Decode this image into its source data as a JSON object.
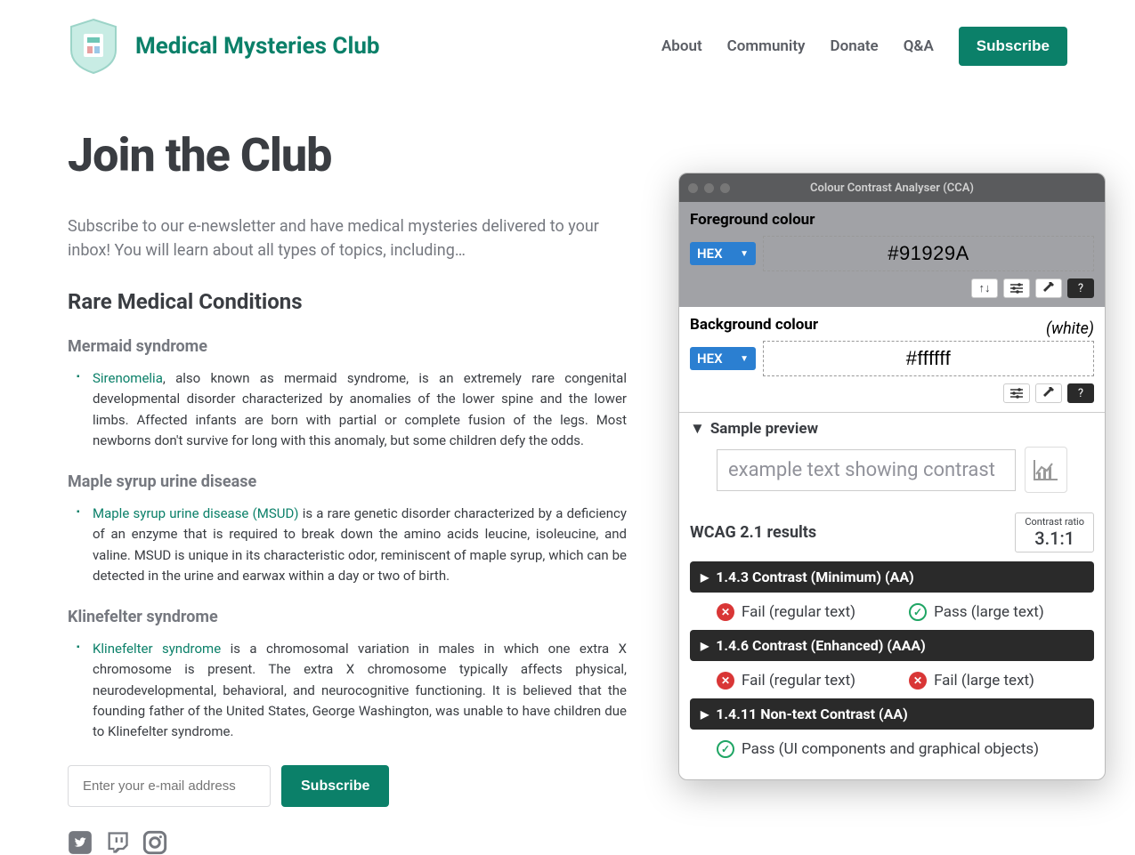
{
  "header": {
    "brand": "Medical Mysteries Club",
    "nav": {
      "about": "About",
      "community": "Community",
      "donate": "Donate",
      "qa": "Q&A"
    },
    "subscribe": "Subscribe"
  },
  "main": {
    "title": "Join the Club",
    "intro": "Subscribe to our e-newsletter and have medical mysteries delivered to your inbox! You will learn about all types of topics, including…",
    "section_heading": "Rare Medical Conditions",
    "conditions": {
      "c1": {
        "heading": "Mermaid syndrome",
        "link": "Sirenomelia",
        "text": ", also known as mermaid syndrome, is an extremely rare congenital developmental disorder characterized by anomalies of the lower spine and the lower limbs. Affected infants are born with partial or complete fusion of the legs. Most newborns don't survive for long with this anomaly, but some children defy the odds."
      },
      "c2": {
        "heading": "Maple syrup urine disease",
        "link": "Maple syrup urine disease (MSUD)",
        "text": " is a rare genetic disorder characterized by a deficiency of an enzyme that is required to break down the amino acids leucine, isoleucine, and valine. MSUD is unique in its characteristic odor, reminiscent of maple syrup, which can be detected in the urine and earwax within a day or two of birth."
      },
      "c3": {
        "heading": "Klinefelter syndrome",
        "link": "Klinefelter syndrome",
        "text": " is a chromosomal variation in males in which one extra X chromosome is present. The extra X chromosome typically affects physical, neurodevelopmental, behavioral, and neurocognitive functioning. It is believed that the founding father of the United States, George Washington, was unable to have children due to Klinefelter syndrome."
      }
    },
    "email_placeholder": "Enter your e-mail address",
    "subscribe_btn": "Subscribe"
  },
  "cca": {
    "title": "Colour Contrast Analyser (CCA)",
    "fg_label": "Foreground colour",
    "bg_label": "Background colour",
    "hex": "HEX",
    "fg_value": "#91929A",
    "bg_value": "#ffffff",
    "white_note": "(white)",
    "sample_label": "Sample preview",
    "sample_text": "example text showing contrast",
    "results_label": "WCAG 2.1 results",
    "ratio_label": "Contrast ratio",
    "ratio_value": "3.1:1",
    "r1": {
      "title": "1.4.3 Contrast (Minimum) (AA)",
      "a": "Fail (regular text)",
      "b": "Pass (large text)"
    },
    "r2": {
      "title": "1.4.6 Contrast (Enhanced) (AAA)",
      "a": "Fail (regular text)",
      "b": "Fail (large text)"
    },
    "r3": {
      "title": "1.4.11 Non-text Contrast (AA)",
      "a": "Pass (UI components and graphical objects)"
    }
  }
}
